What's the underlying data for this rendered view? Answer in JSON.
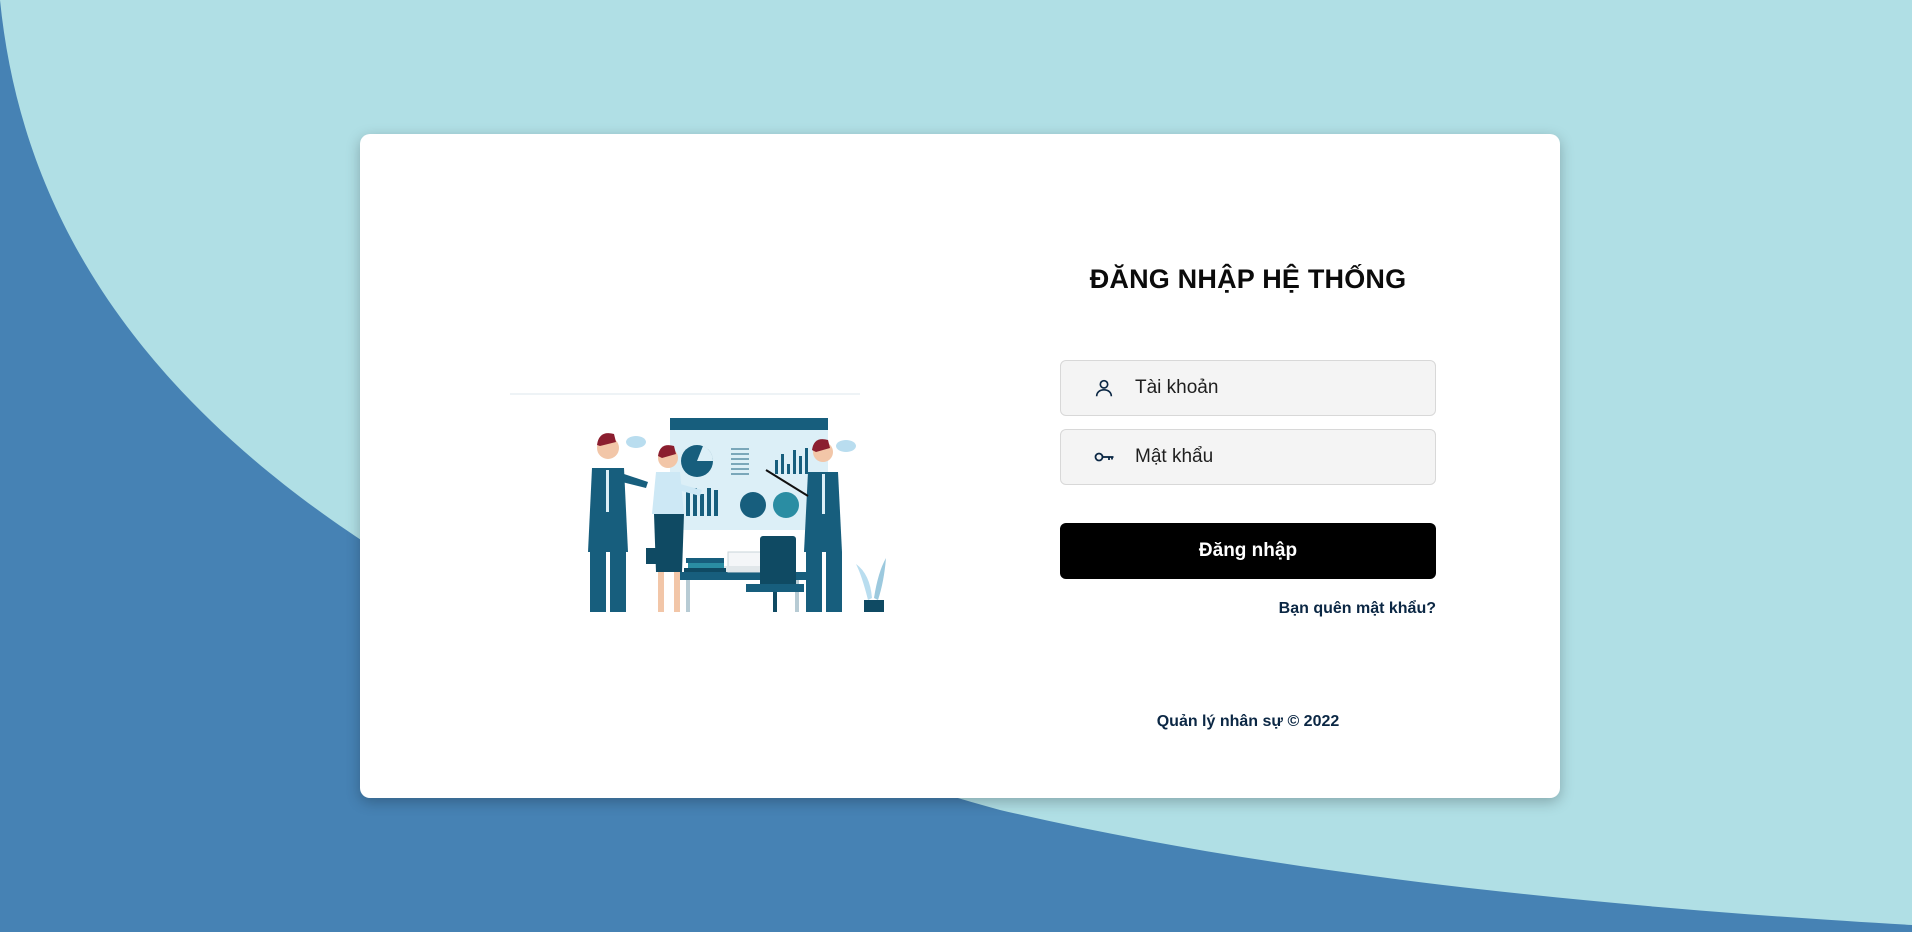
{
  "colors": {
    "background_light": "#b0dfe5",
    "background_dark": "#4682b4",
    "card": "#ffffff",
    "button": "#000000",
    "link": "#0b2744"
  },
  "login": {
    "title": "ĐĂNG NHẬP HỆ THỐNG",
    "username": {
      "placeholder": "Tài khoản",
      "value": "",
      "icon": "user-icon"
    },
    "password": {
      "placeholder": "Mật khẩu",
      "value": "",
      "icon": "key-icon"
    },
    "submit_label": "Đăng nhập",
    "forgot_label": "Bạn quên mật khẩu?"
  },
  "footer": {
    "text": "Quản lý nhân sự © 2022"
  },
  "illustration": {
    "icon": "business-meeting-illustration"
  }
}
